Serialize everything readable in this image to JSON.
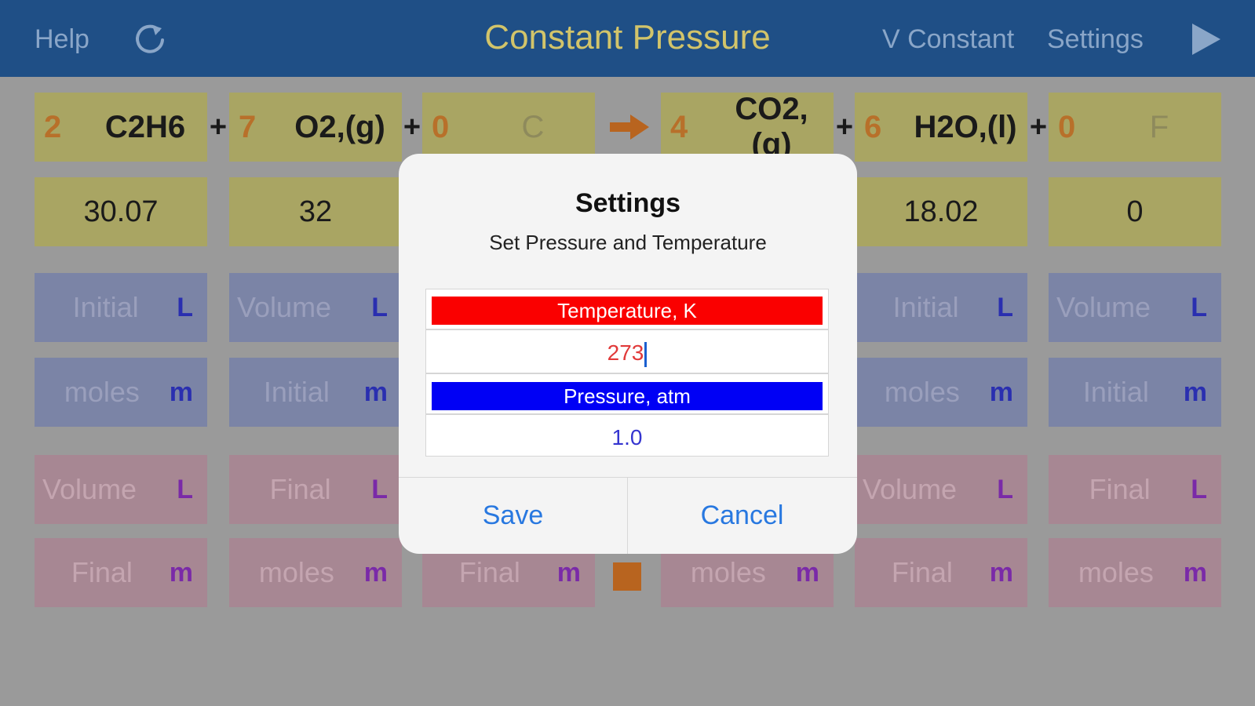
{
  "header": {
    "help": "Help",
    "title": "Constant Pressure",
    "v_constant": "V Constant",
    "settings": "Settings",
    "icons": {
      "refresh": "refresh-icon",
      "play": "play-icon"
    }
  },
  "reactants": [
    {
      "coef": "2",
      "name": "C2H6",
      "mass": "30.07"
    },
    {
      "coef": "7",
      "name": "O2,(g)",
      "mass": "32"
    },
    {
      "coef": "0",
      "name": "C",
      "mass": ""
    }
  ],
  "products": [
    {
      "coef": "4",
      "name": "CO2,(g)",
      "mass": ""
    },
    {
      "coef": "6",
      "name": "H2O,(l)",
      "mass": "18.02"
    },
    {
      "coef": "0",
      "name": "F",
      "mass": "0"
    }
  ],
  "plus": "+",
  "grid": {
    "row3": [
      {
        "label": "Initial",
        "unit": "L"
      },
      {
        "label": "Volume",
        "unit": "L"
      },
      {
        "label": "",
        "unit": ""
      },
      {
        "label": "",
        "unit": ""
      },
      {
        "label": "Initial",
        "unit": "L"
      },
      {
        "label": "Volume",
        "unit": "L"
      }
    ],
    "row4": [
      {
        "label": "moles",
        "unit": "m"
      },
      {
        "label": "Initial",
        "unit": "m"
      },
      {
        "label": "",
        "unit": ""
      },
      {
        "label": "",
        "unit": ""
      },
      {
        "label": "moles",
        "unit": "m"
      },
      {
        "label": "Initial",
        "unit": "m"
      }
    ],
    "row5": [
      {
        "label": "Volume",
        "unit": "L"
      },
      {
        "label": "Final",
        "unit": "L"
      },
      {
        "label": "",
        "unit": ""
      },
      {
        "label": "",
        "unit": ""
      },
      {
        "label": "Volume",
        "unit": "L"
      },
      {
        "label": "Final",
        "unit": "L"
      }
    ],
    "row6": [
      {
        "label": "Final",
        "unit": "m"
      },
      {
        "label": "moles",
        "unit": "m"
      },
      {
        "label": "Final",
        "unit": "m"
      },
      {
        "label": "moles",
        "unit": "m"
      },
      {
        "label": "Final",
        "unit": "m"
      },
      {
        "label": "moles",
        "unit": "m"
      }
    ]
  },
  "dialog": {
    "title": "Settings",
    "subtitle": "Set Pressure and Temperature",
    "temperature_label": "Temperature, K",
    "temperature_value": "273",
    "pressure_label": "Pressure, atm",
    "pressure_value": "1.0",
    "save": "Save",
    "cancel": "Cancel"
  },
  "colors": {
    "header_bg": "#1f4f86",
    "title": "#d2c46a",
    "temperature_bar": "#fa0000",
    "pressure_bar": "#0000f5",
    "button_text": "#2878e0"
  }
}
